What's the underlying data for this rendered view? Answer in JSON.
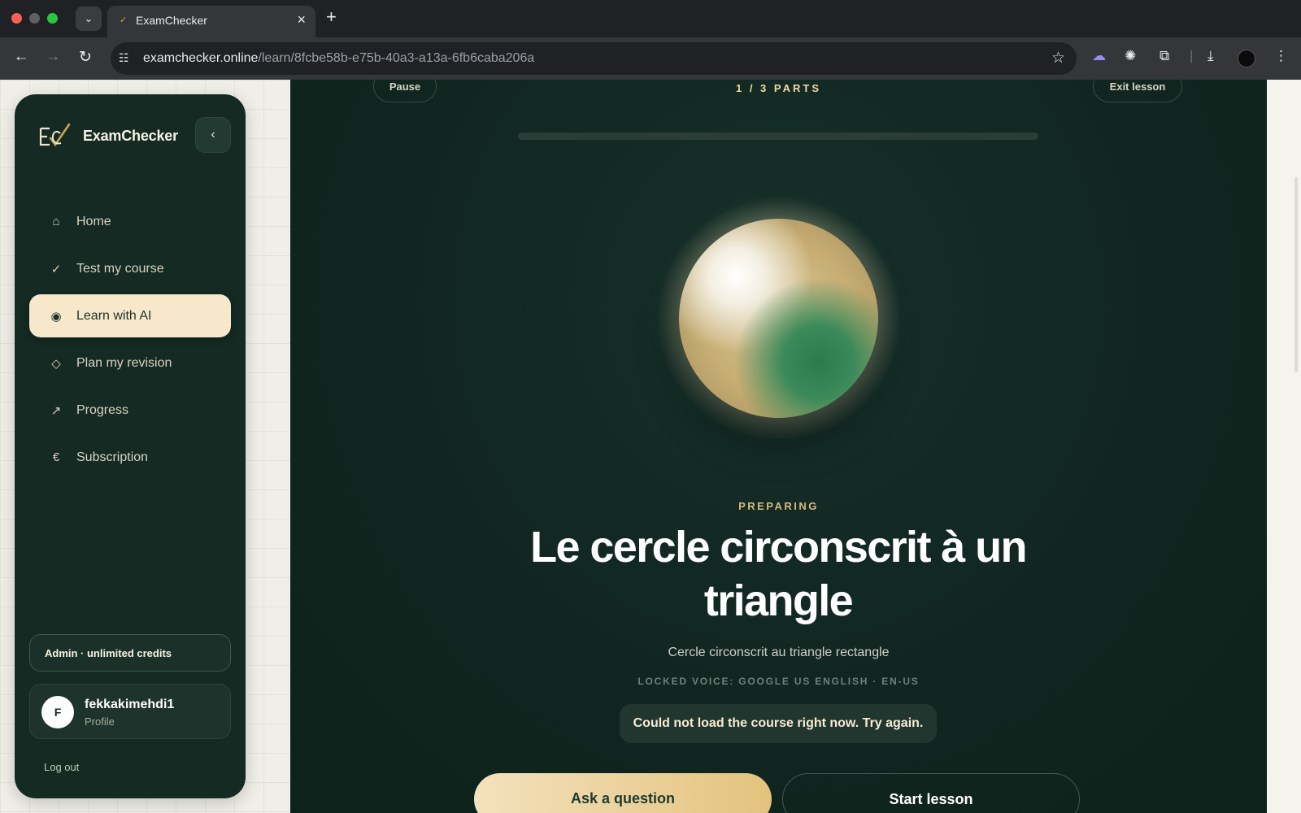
{
  "browser": {
    "tab_title": "ExamChecker",
    "url_host": "examchecker.online",
    "url_path": "/learn/8fcbe58b-e75b-40a3-a13a-6fb6caba206a"
  },
  "sidebar": {
    "brand": "ExamChecker",
    "items": [
      {
        "label": "Home",
        "icon": "⌂",
        "icon_name": "home-icon"
      },
      {
        "label": "Test my course",
        "icon": "✓",
        "icon_name": "check-icon"
      },
      {
        "label": "Learn with AI",
        "icon": "◉",
        "icon_name": "radio-dot-icon",
        "active": true
      },
      {
        "label": "Plan my revision",
        "icon": "◇",
        "icon_name": "diamond-icon"
      },
      {
        "label": "Progress",
        "icon": "↗",
        "icon_name": "trend-arrow-icon"
      },
      {
        "label": "Subscription",
        "icon": "€",
        "icon_name": "euro-icon"
      }
    ],
    "credits": "Admin · unlimited credits",
    "profile": {
      "initial": "F",
      "name": "fekkakimehdi1",
      "subtitle": "Profile"
    },
    "logout": "Log out"
  },
  "lesson": {
    "pause": "Pause",
    "parts": "1 / 3 PARTS",
    "exit": "Exit lesson",
    "progress_fraction": 0.0,
    "status": "PREPARING",
    "title": "Le cercle circonscrit à un triangle",
    "subtitle": "Cercle circonscrit au triangle rectangle",
    "voice": "LOCKED VOICE: GOOGLE US ENGLISH · EN-US",
    "error": "Could not load the course right now. Try again.",
    "ask_button": "Ask a question",
    "start_button": "Start lesson"
  },
  "colors": {
    "sidebar_bg": "#142a23",
    "accent_cream": "#f7e8cc",
    "gold": "#d9b867"
  }
}
